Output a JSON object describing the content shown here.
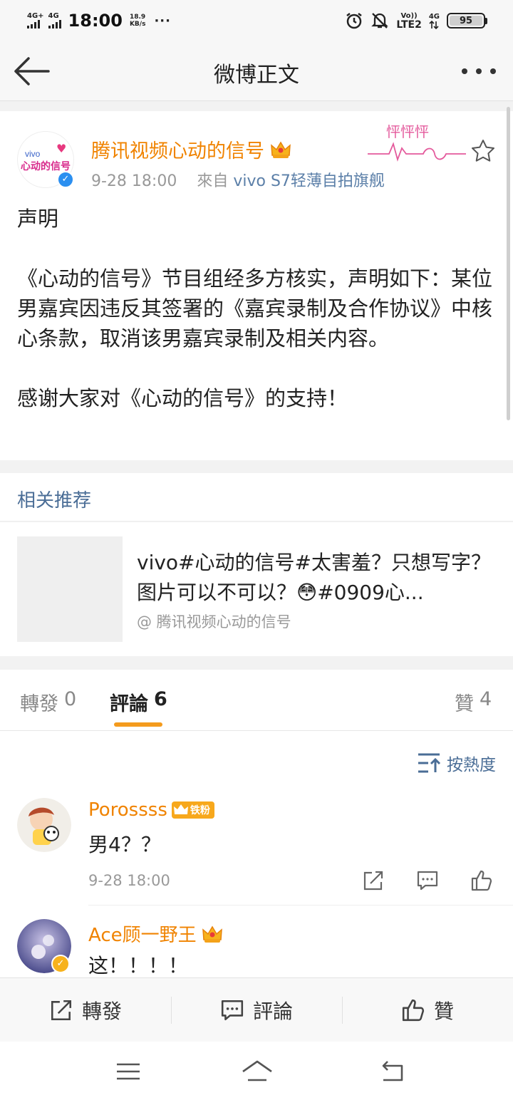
{
  "status_bar": {
    "sim1": "4G+",
    "sim2": "4G",
    "time": "18:00",
    "speed_value": "18.9",
    "speed_unit": "KB/s",
    "more": "···",
    "volte_top": "Vo))",
    "volte_bottom": "LTE2",
    "net4g": "4G",
    "battery": "95"
  },
  "nav": {
    "title": "微博正文"
  },
  "post": {
    "author": "腾讯视频心动的信号",
    "avatar_brand": "vivo",
    "avatar_text": "心动的信号",
    "time": "9-28 18:00",
    "source_prefix": "來自",
    "source": "vivo S7轻薄自拍旗舰",
    "deco_text": "怦怦怦",
    "body": [
      "声明",
      "",
      "《心动的信号》节目组经多方核实，声明如下：某位男嘉宾因违反其签署的《嘉宾录制及合作协议》中核心条款，取消该男嘉宾录制及相关内容。",
      "",
      "感谢大家对《心动的信号》的支持！"
    ]
  },
  "related": {
    "heading": "相关推荐",
    "item": {
      "title": "vivo#心动的信号#太害羞？只想写字？图片可以不可以？😳#0909心...",
      "source": "@ 腾讯视频心动的信号"
    }
  },
  "tabs": [
    {
      "label": "轉發",
      "count": "0"
    },
    {
      "label": "評論",
      "count": "6"
    },
    {
      "label": "贊",
      "count": "4"
    }
  ],
  "comments": {
    "sort_label": "按熱度",
    "items": [
      {
        "name": "Porossss",
        "badge": "铁粉",
        "text": "男4？？",
        "time": "9-28 18:00"
      },
      {
        "name": "Ace顾一野王",
        "text": "这！！！！"
      }
    ]
  },
  "action_bar": {
    "repost": "轉發",
    "comment": "評論",
    "like": "贊"
  },
  "colors": {
    "accent_orange": "#f08300",
    "link_blue": "#4a6d96",
    "tab_underline": "#f49b1d"
  }
}
